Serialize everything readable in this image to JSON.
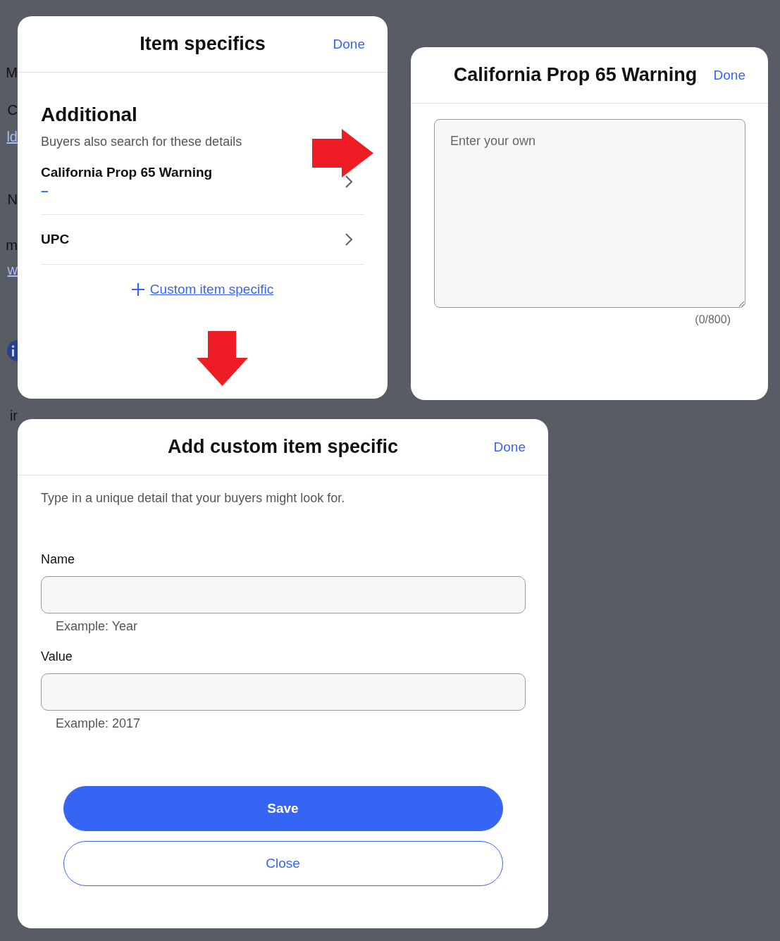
{
  "background_fragments": [
    {
      "kind": "text",
      "text": "M"
    },
    {
      "kind": "text",
      "text": "C"
    },
    {
      "kind": "link",
      "text": "ld"
    },
    {
      "kind": "text",
      "text": "N"
    },
    {
      "kind": "text",
      "text": "m"
    },
    {
      "kind": "link",
      "text": "w"
    },
    {
      "kind": "info"
    },
    {
      "kind": "text",
      "text": "ir"
    }
  ],
  "item_specifics_panel": {
    "title": "Item specifics",
    "done": "Done",
    "section_title": "Additional",
    "section_subtitle": "Buyers also search for these details",
    "rows": [
      {
        "label": "California Prop 65 Warning",
        "value": "–"
      },
      {
        "label": "UPC"
      }
    ],
    "custom_link": "Custom item specific"
  },
  "prop65_panel": {
    "title": "California Prop 65 Warning",
    "done": "Done",
    "placeholder": "Enter your own",
    "counter": "(0/800)"
  },
  "custom_panel": {
    "title": "Add custom item specific",
    "done": "Done",
    "description": "Type in a unique detail that your buyers might look for.",
    "fields": [
      {
        "label": "Name",
        "helper": "Example: Year"
      },
      {
        "label": "Value",
        "helper": "Example: 2017"
      }
    ],
    "buttons": [
      {
        "kind": "primary",
        "label": "Save"
      },
      {
        "kind": "secondary",
        "label": "Close"
      }
    ]
  }
}
